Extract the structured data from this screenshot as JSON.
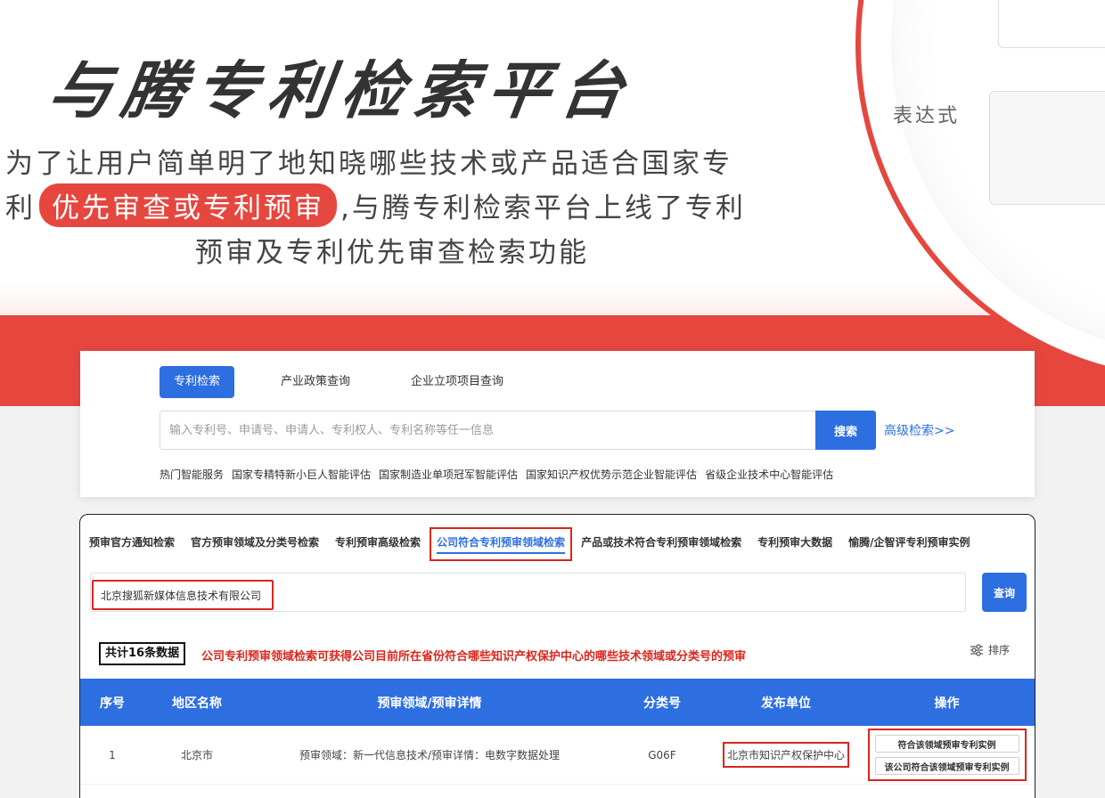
{
  "hero": {
    "title": "与腾专利检索平台",
    "line1": "为了让用户简单明了地知晓哪些技术或产品适合国家专",
    "line2_prefix": "利",
    "line2_highlight": "优先审查或专利预审",
    "line2_suffix": ",与腾专利检索平台上线了专利",
    "line3": "预审及专利优先审查检索功能",
    "mock_label": "表达式",
    "accent_color": "#e5473f"
  },
  "search": {
    "tabs": [
      {
        "label": "专利检索",
        "active": true
      },
      {
        "label": "产业政策查询",
        "active": false
      },
      {
        "label": "企业立项项目查询",
        "active": false
      }
    ],
    "placeholder": "输入专利号、申请号、申请人、专利权人、专利名称等任一信息",
    "button": "搜索",
    "advanced": "高级检索>>",
    "hot_items": [
      "热门智能服务",
      "国家专精特新小巨人智能评估",
      "国家制造业单项冠军智能评估",
      "国家知识产权优势示范企业智能评估",
      "省级企业技术中心智能评估"
    ]
  },
  "results": {
    "tabs": [
      {
        "label": "预审官方通知检索",
        "active": false
      },
      {
        "label": "官方预审领域及分类号检索",
        "active": false
      },
      {
        "label": "专利预审高级检索",
        "active": false
      },
      {
        "label": "公司符合专利预审领域检索",
        "active": true
      },
      {
        "label": "产品或技术符合专利预审领域检索",
        "active": false
      },
      {
        "label": "专利预审大数据",
        "active": false
      },
      {
        "label": "愉腾/企智评专利预审实例",
        "active": false
      }
    ],
    "company_value": "北京搜狐新媒体信息技术有限公司",
    "query_button": "查询",
    "count": "共计16条数据",
    "description": "公司专利预审领域检索可获得公司目前所在省份符合哪些知识产权保护中心的哪些技术领域或分类号的预审",
    "sort": "排序",
    "headers": [
      "序号",
      "地区名称",
      "预审领域/预审详情",
      "分类号",
      "发布单位",
      "操作"
    ],
    "rows": [
      {
        "index": "1",
        "region": "北京市",
        "field": "预审领域：新一代信息技术/预审详情：电数字数据处理",
        "class": "G06F",
        "unit": "北京市知识产权保护中心",
        "op1": "符合该领域预审专利实例",
        "op2": "该公司符合该领域预审专利实例"
      }
    ],
    "primary_color": "#2d6fe0",
    "highlight_color": "#d9261c"
  }
}
